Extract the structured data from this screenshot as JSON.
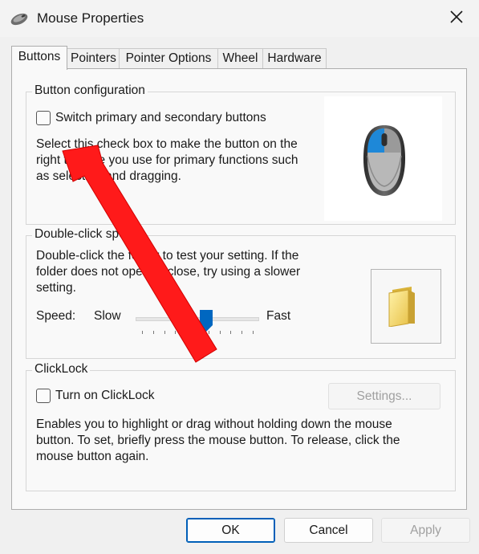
{
  "window": {
    "title": "Mouse Properties"
  },
  "tabs": [
    {
      "label": "Buttons"
    },
    {
      "label": "Pointers"
    },
    {
      "label": "Pointer Options"
    },
    {
      "label": "Wheel"
    },
    {
      "label": "Hardware"
    }
  ],
  "button_config": {
    "title": "Button configuration",
    "switch_label": "Switch primary and secondary buttons",
    "switch_checked": false,
    "description_lines": [
      "Select this check box to make the button on the",
      "right the one you use for primary functions such",
      "as selecting and dragging."
    ]
  },
  "double_click": {
    "title": "Double-click speed",
    "description_lines": [
      "Double-click the folder to test your setting. If the",
      "folder does not open or close, try using a slower",
      "setting."
    ],
    "speed_label": "Speed:",
    "slow_label": "Slow",
    "fast_label": "Fast",
    "speed_value": 0.58
  },
  "clicklock": {
    "title": "ClickLock",
    "turn_on_label": "Turn on ClickLock",
    "turn_on_checked": false,
    "settings_label": "Settings...",
    "description_lines": [
      "Enables you to highlight or drag without holding down the mouse",
      "button. To set, briefly press the mouse button. To release, click the",
      "mouse button again."
    ]
  },
  "footer": {
    "ok_label": "OK",
    "cancel_label": "Cancel",
    "apply_label": "Apply"
  },
  "colors": {
    "annotation_arrow": "#ff1a1a",
    "accent": "#005fb8",
    "mouse_highlight": "#1e88d8"
  },
  "icons": {
    "app": "mouse-icon",
    "close": "close-icon",
    "folder": "folder-icon",
    "mouse_preview": "mouse-icon"
  }
}
